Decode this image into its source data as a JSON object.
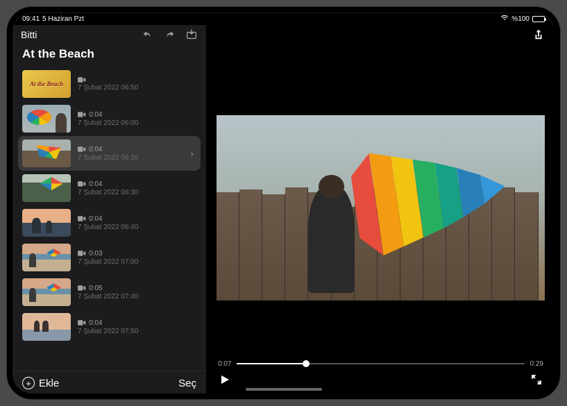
{
  "status": {
    "time": "09:41",
    "date": "5 Haziran Pzt",
    "battery": "%100"
  },
  "sidebar": {
    "done": "Bitti",
    "project_title": "At the Beach",
    "add_label": "Ekle",
    "select_label": "Seç",
    "clips": [
      {
        "title_card": "At the Beach",
        "duration": "",
        "date": "7 Şubat 2022 06:50",
        "selected": false,
        "thumb": "th-title"
      },
      {
        "duration": "0:04",
        "date": "7 Şubat 2022 06:00",
        "selected": false,
        "thumb": "th-mural"
      },
      {
        "duration": "0:04",
        "date": "7 Şubat 2022 06:10",
        "selected": true,
        "thumb": "th-fence"
      },
      {
        "duration": "0:04",
        "date": "7 Şubat 2022 06:30",
        "selected": false,
        "thumb": "th-green"
      },
      {
        "duration": "0:04",
        "date": "7 Şubat 2022 06:40",
        "selected": false,
        "thumb": "th-sunset"
      },
      {
        "duration": "0:03",
        "date": "7 Şubat 2022 07:00",
        "selected": false,
        "thumb": "th-beach"
      },
      {
        "duration": "0:05",
        "date": "7 Şubat 2022 07:40",
        "selected": false,
        "thumb": "th-beach"
      },
      {
        "duration": "0:04",
        "date": "7 Şubat 2022 07:50",
        "selected": false,
        "thumb": "th-pier"
      }
    ]
  },
  "preview": {
    "current_time": "0:07",
    "total_time": "0:29",
    "progress_pct": 24
  }
}
